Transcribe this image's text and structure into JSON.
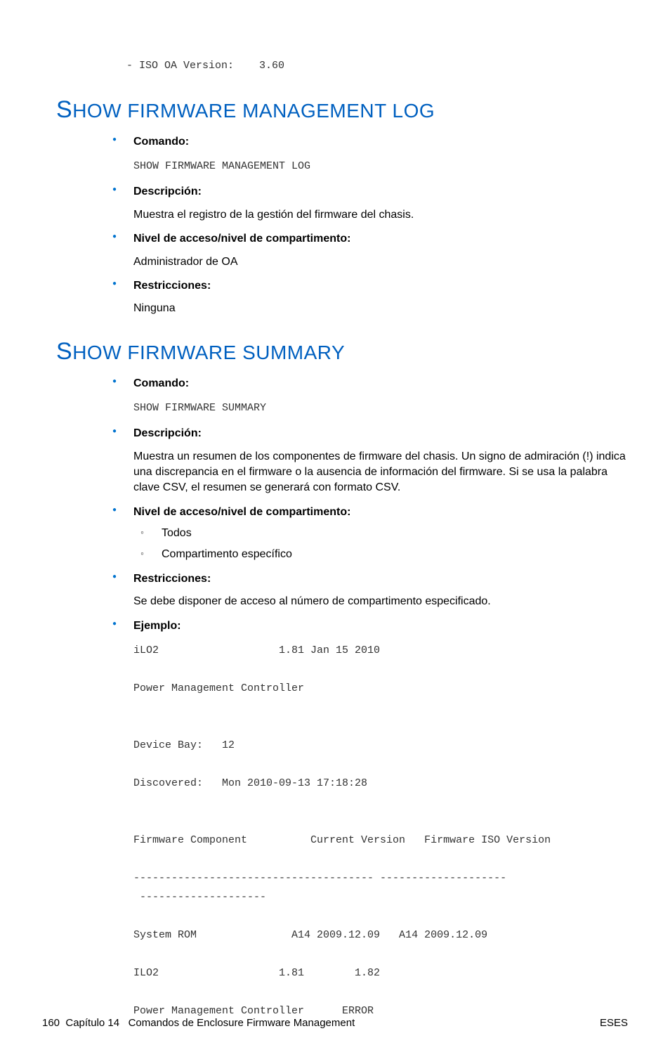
{
  "top_line": "- ISO OA Version:    3.60",
  "section1": {
    "heading_first": "S",
    "heading_rest": "HOW FIRMWARE MANAGEMENT LOG",
    "items": {
      "comando_label": "Comando:",
      "comando_value": "SHOW FIRMWARE MANAGEMENT LOG",
      "descripcion_label": "Descripción:",
      "descripcion_value": "Muestra el registro de la gestión del firmware del chasis.",
      "nivel_label": "Nivel de acceso/nivel de compartimento:",
      "nivel_value": "Administrador de OA",
      "restricciones_label": "Restricciones:",
      "restricciones_value": "Ninguna"
    }
  },
  "section2": {
    "heading_first": "S",
    "heading_rest": "HOW FIRMWARE SUMMARY",
    "items": {
      "comando_label": "Comando:",
      "comando_value": "SHOW FIRMWARE SUMMARY",
      "descripcion_label": "Descripción:",
      "descripcion_value": "Muestra un resumen de los componentes de firmware del chasis. Un signo de admiración (!) indica una discrepancia en el firmware o la ausencia de información del firmware. Si se usa la palabra clave CSV, el resumen se generará con formato CSV.",
      "nivel_label": "Nivel de acceso/nivel de compartimento:",
      "nivel_sub1": "Todos",
      "nivel_sub2": "Compartimento específico",
      "restricciones_label": "Restricciones:",
      "restricciones_value": "Se debe disponer de acceso al número de compartimento especificado.",
      "ejemplo_label": "Ejemplo:",
      "ejemplo_block": "iLO2                   1.81 Jan 15 2010\n\nPower Management Controller\n\n\nDevice Bay:   12\n\nDiscovered:   Mon 2010-09-13 17:18:28\n\n\nFirmware Component          Current Version   Firmware ISO Version\n\n-------------------------------------- --------------------\n --------------------\n\nSystem ROM               A14 2009.12.09   A14 2009.12.09\n\nILO2                   1.81        1.82\n\nPower Management Controller      ERROR"
    }
  },
  "footer": {
    "page_num": "160",
    "chapter": "Capítulo 14   Comandos de Enclosure Firmware Management",
    "right": "ESES"
  }
}
